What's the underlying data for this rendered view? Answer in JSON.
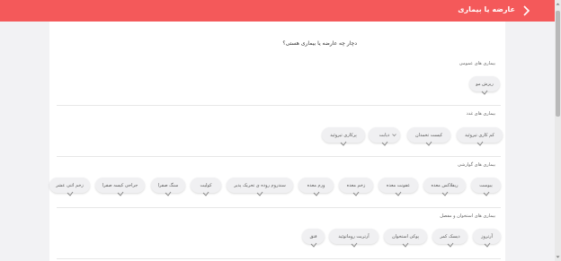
{
  "header": {
    "title": "عارضه یا بیماری"
  },
  "question": "دچار چه عارضه یا بیماری هستی؟",
  "sections": [
    {
      "title": "بیماری های عمومی",
      "items": [
        "ریزش مو"
      ]
    },
    {
      "title": "بیماری های غدد",
      "items": [
        "کم کاری تیروئید",
        "کیست تخمدان",
        "دیابت",
        "پرکاری تیروئید"
      ]
    },
    {
      "title": "بیماری های گوارشی",
      "items": [
        "یبوست",
        "ریفلاکس معده",
        "عفونت معده",
        "زخم معده",
        "ورم معده",
        "سندروم روده ی تحریک پذیر",
        "کولیت",
        "سنگ صفرا",
        "جراحی کیسه صفرا",
        "زخم اثنی عشر"
      ]
    },
    {
      "title": "بیماری های استخوان و مفصل",
      "items": [
        "آرتروز",
        "دیسک کمر",
        "پوکی استخوان",
        "آرتریت روماتوئید",
        "فتق"
      ]
    }
  ],
  "colors": {
    "accent": "#f4595a",
    "card": "#ffffff",
    "page": "#f2f2f4"
  }
}
